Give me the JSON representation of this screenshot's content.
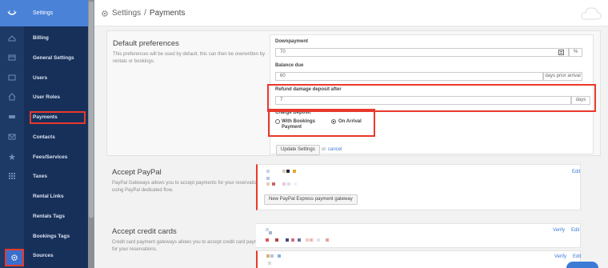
{
  "nav": {
    "title": "Settings",
    "items": [
      {
        "label": "Billing"
      },
      {
        "label": "General Settings"
      },
      {
        "label": "Users"
      },
      {
        "label": "User Roles"
      },
      {
        "label": "Payments"
      },
      {
        "label": "Contacts"
      },
      {
        "label": "Fees/Services"
      },
      {
        "label": "Taxes"
      },
      {
        "label": "Rental Links"
      },
      {
        "label": "Rentals Tags"
      },
      {
        "label": "Bookings Tags"
      },
      {
        "label": "Sources"
      }
    ],
    "active": "Payments"
  },
  "breadcrumb": {
    "root": "Settings",
    "separator": "/",
    "current": "Payments"
  },
  "defaults": {
    "title": "Default preferences",
    "description": "This preferences will be used by default, this can then be overwritten by rentals or bookings.",
    "downpayment_label": "Downpayment",
    "downpayment_value": "70",
    "downpayment_unit": "%",
    "balance_label": "Balance due",
    "balance_value": "60",
    "balance_unit": "days prior arrival",
    "refund_label": "Refund damage deposit after",
    "refund_value": "7",
    "refund_unit": "days",
    "charge_label": "Charge Deposit",
    "option_with_bookings_line1": "With Bookings",
    "option_with_bookings_line2": "Payment",
    "option_on_arrival": "On Arrival",
    "selected_option": "On Arrival",
    "update_button": "Update Settings",
    "or_text": "or",
    "cancel_link": "cancel"
  },
  "paypal": {
    "title": "Accept PayPal",
    "description": "PayPal Gateways allows you to accept payments for your reservations using PayPal dedicated flow.",
    "edit_link": "Edit",
    "new_gateway_button": "New PayPal Express payment gateway"
  },
  "credit_cards": {
    "title": "Accept credit cards",
    "description": "Credit card payment gateways allows you to accept credit card payments for your reservations.",
    "verify_link": "Verify",
    "edit_link": "Edit"
  },
  "colors": {
    "accent": "#4a82d8",
    "sidebar": "#173059",
    "highlight": "#e8392c",
    "link": "#3a7bd5"
  }
}
